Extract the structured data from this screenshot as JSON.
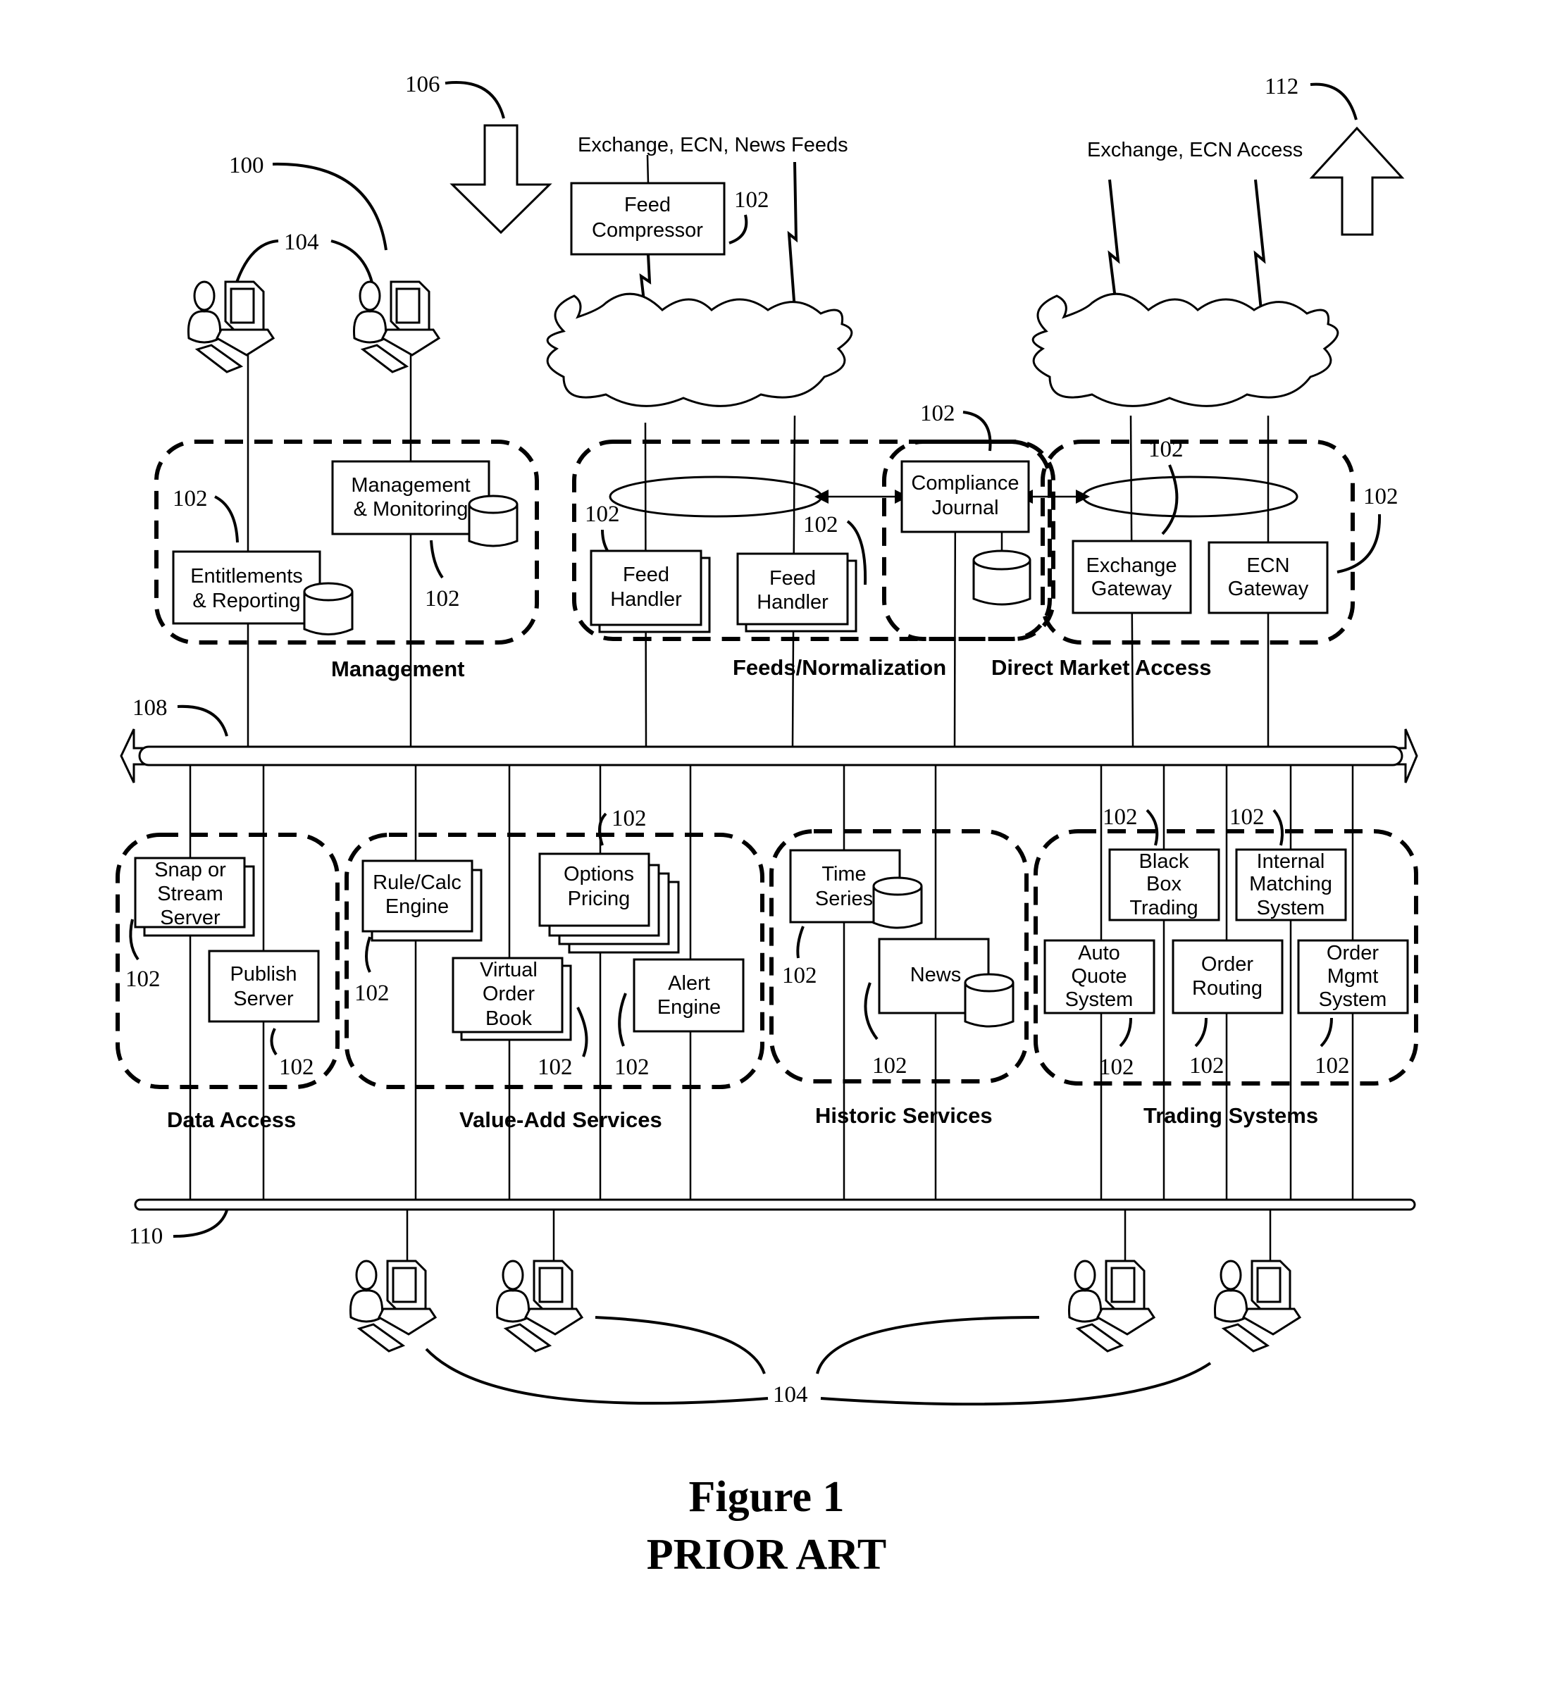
{
  "figure": {
    "caption": "Figure 1",
    "subcaption": "PRIOR ART"
  },
  "refs": {
    "system": "100",
    "component": "102",
    "users": "104",
    "inbound": "106",
    "bus_top": "108",
    "bus_bottom": "110",
    "outbound": "112"
  },
  "external": {
    "feeds_label": "Exchange, ECN, News Feeds",
    "access_label": "Exchange, ECN Access"
  },
  "groups": {
    "management": "Management",
    "feeds": "Feeds/Normalization",
    "dma": "Direct Market Access",
    "data_access": "Data Access",
    "value_add": "Value-Add Services",
    "historic": "Historic Services",
    "trading": "Trading Systems"
  },
  "components": {
    "feed_compressor": [
      "Feed",
      "Compressor"
    ],
    "entitlements": [
      "Entitlements",
      "& Reporting"
    ],
    "mgmt_monitoring": [
      "Management",
      "& Monitoring"
    ],
    "feed_handler_1": [
      "Feed",
      "Handler"
    ],
    "feed_handler_2": [
      "Feed",
      "Handler"
    ],
    "compliance": [
      "Compliance",
      "Journal"
    ],
    "exchange_gw": [
      "Exchange",
      "Gateway"
    ],
    "ecn_gw": [
      "ECN",
      "Gateway"
    ],
    "snap_stream": [
      "Snap or",
      "Stream",
      "Server"
    ],
    "publish": [
      "Publish",
      "Server"
    ],
    "rule_calc": [
      "Rule/Calc",
      "Engine"
    ],
    "options": [
      "Options",
      "Pricing"
    ],
    "virtual_order": [
      "Virtual",
      "Order",
      "Book"
    ],
    "alert": [
      "Alert",
      "Engine"
    ],
    "time_series": [
      "Time",
      "Series"
    ],
    "news": [
      "News"
    ],
    "black_box": [
      "Black",
      "Box",
      "Trading"
    ],
    "internal_matching": [
      "Internal",
      "Matching",
      "System"
    ],
    "auto_quote": [
      "Auto",
      "Quote",
      "System"
    ],
    "order_routing": [
      "Order",
      "Routing"
    ],
    "order_mgmt": [
      "Order",
      "Mgmt",
      "System"
    ]
  }
}
